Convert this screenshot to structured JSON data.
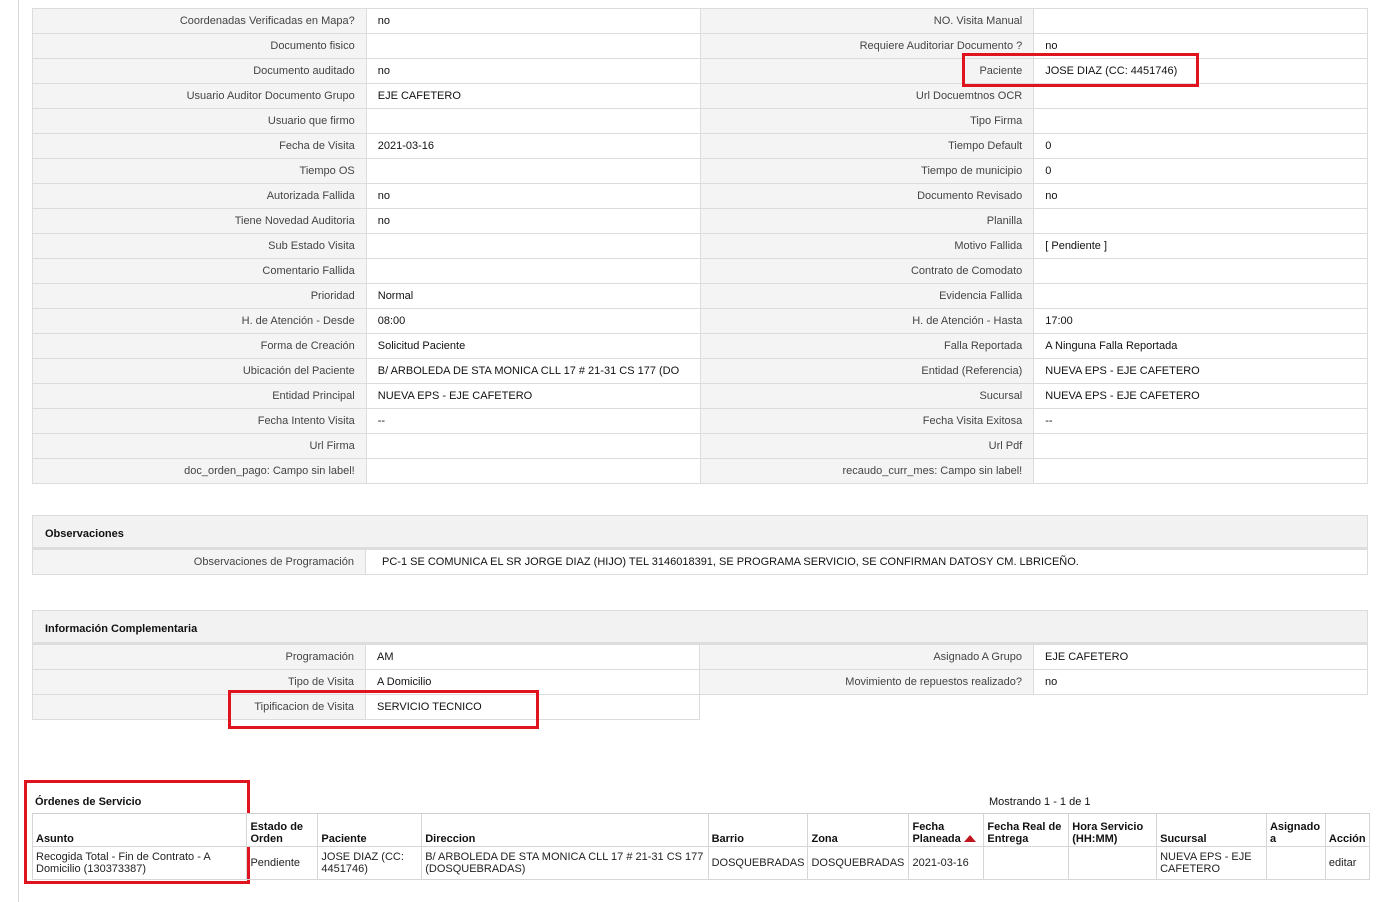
{
  "details": [
    [
      "Coordenadas Verificadas en Mapa?",
      "no",
      "NO. Visita Manual",
      ""
    ],
    [
      "Documento fisico",
      "",
      "Requiere Auditoriar Documento ?",
      "no"
    ],
    [
      "Documento auditado",
      "no",
      "Paciente",
      "JOSE DIAZ (CC: 4451746)"
    ],
    [
      "Usuario Auditor Documento Grupo",
      "EJE CAFETERO",
      "Url Docuemtnos OCR",
      ""
    ],
    [
      "Usuario que firmo",
      "",
      "Tipo Firma",
      ""
    ],
    [
      "Fecha de Visita",
      "2021-03-16",
      "Tiempo Default",
      "0"
    ],
    [
      "Tiempo OS",
      "",
      "Tiempo de municipio",
      "0"
    ],
    [
      "Autorizada Fallida",
      "no",
      "Documento Revisado",
      "no"
    ],
    [
      "Tiene Novedad Auditoria",
      "no",
      "Planilla",
      ""
    ],
    [
      "Sub Estado Visita",
      "",
      "Motivo Fallida",
      "[ Pendiente ]"
    ],
    [
      "Comentario Fallida",
      "",
      "Contrato de Comodato",
      ""
    ],
    [
      "Prioridad",
      "Normal",
      "Evidencia Fallida",
      ""
    ],
    [
      "H. de Atención - Desde",
      "08:00",
      "H. de Atención - Hasta",
      "17:00"
    ],
    [
      "Forma de Creación",
      "Solicitud Paciente",
      "Falla Reportada",
      "A Ninguna Falla Reportada"
    ],
    [
      "Ubicación del Paciente",
      "B/ ARBOLEDA DE STA MONICA CLL 17 # 21-31 CS 177 (DO",
      "Entidad (Referencia)",
      "NUEVA EPS - EJE CAFETERO"
    ],
    [
      "Entidad Principal",
      "NUEVA EPS - EJE CAFETERO",
      "Sucursal",
      "NUEVA EPS - EJE CAFETERO"
    ],
    [
      "Fecha Intento Visita",
      "--",
      "Fecha Visita Exitosa",
      "--"
    ],
    [
      "Url Firma",
      "",
      "Url Pdf",
      ""
    ],
    [
      "doc_orden_pago: Campo sin label!",
      "",
      "recaudo_curr_mes: Campo sin label!",
      ""
    ]
  ],
  "observaciones": {
    "title": "Observaciones",
    "label": "Observaciones de Programación",
    "value": "PC-1 SE COMUNICA EL SR JORGE DIAZ (HIJO) TEL 3146018391, SE PROGRAMA SERVICIO, SE CONFIRMAN DATOSY CM. LBRICEÑO."
  },
  "complementaria": {
    "title": "Información Complementaria",
    "rows": [
      [
        "Programación",
        "AM",
        "Asignado A Grupo",
        "EJE CAFETERO"
      ],
      [
        "Tipo de Visita",
        "A Domicilio",
        "Movimiento de repuestos realizado?",
        "no"
      ]
    ],
    "last_label": "Tipificacion de Visita",
    "last_value": "SERVICIO TECNICO"
  },
  "orders": {
    "title": "Órdenes de Servicio",
    "count": "Mostrando 1 - 1 de 1",
    "headers": [
      "Asunto",
      "Estado de Orden",
      "Paciente",
      "Direccion",
      "Barrio",
      "Zona",
      "Fecha Planeada",
      "Fecha Real de Entrega",
      "Hora Servicio (HH:MM)",
      "Sucursal",
      "Asignado a",
      "Acción"
    ],
    "row": {
      "asunto": "Recogida Total - Fin de Contrato - A Domicilio (130373387)",
      "estado": "Pendiente",
      "paciente": "JOSE DIAZ (CC: 4451746)",
      "direccion": "B/ ARBOLEDA DE STA MONICA CLL 17 # 21-31 CS 177 (DOSQUEBRADAS)",
      "barrio": "DOSQUEBRADAS",
      "zona": "DOSQUEBRADAS",
      "fecha_planeada": "2021-03-16",
      "fecha_real": "",
      "hora": "",
      "sucursal": "NUEVA EPS - EJE CAFETERO",
      "asignado": "",
      "accion": "editar"
    }
  },
  "colors": {
    "highlight": "#e0141e",
    "label_bg": "#f4f4f4",
    "sort_arrow": "#c0141e"
  }
}
